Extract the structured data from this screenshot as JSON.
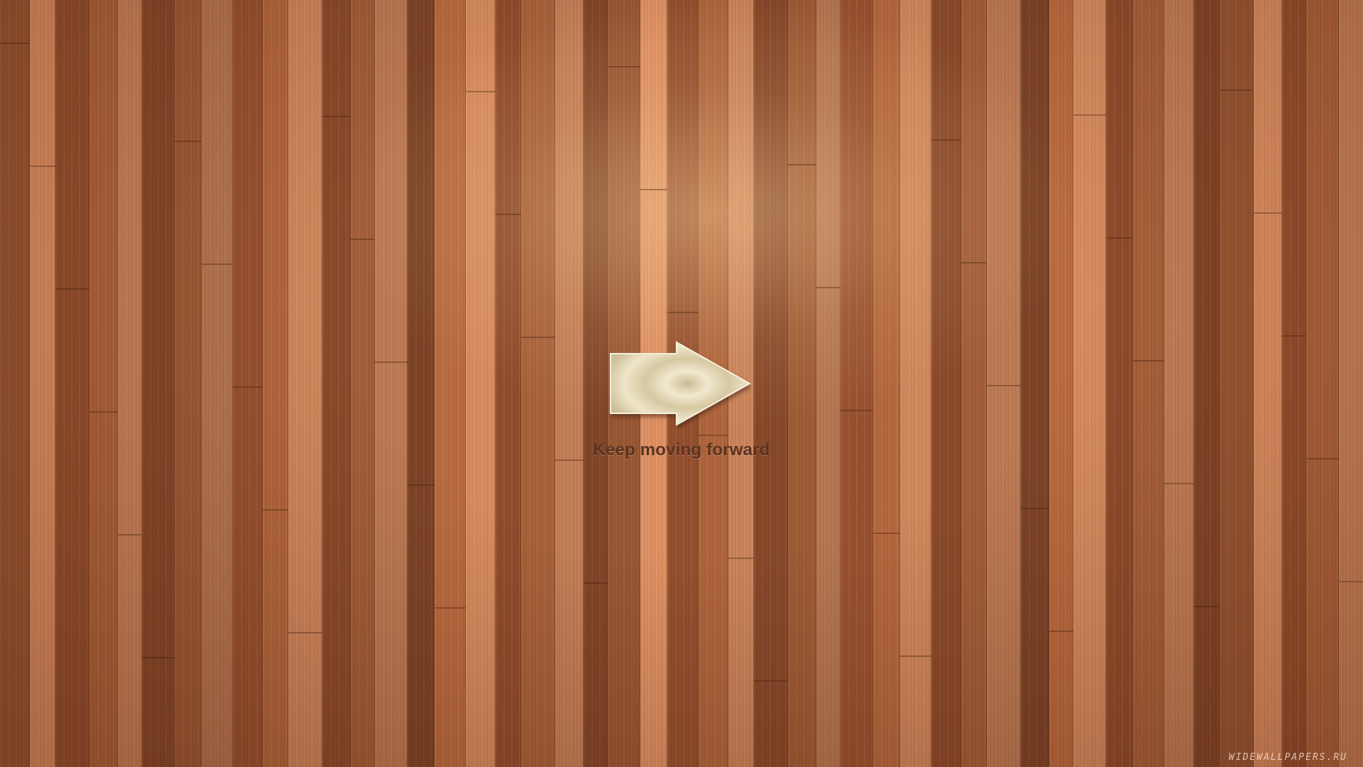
{
  "wallpaper": {
    "tagline": "Keep moving forward",
    "watermark": "WIDEWALLPAPERS.RU",
    "arrow_icon": "right-arrow-icon",
    "colors": {
      "wood_base": "#a8613a",
      "wood_light": "#c9835a",
      "wood_dark": "#8a4a2b",
      "text": "#5a3322",
      "arrow_metal": "#e2d6b6"
    }
  }
}
